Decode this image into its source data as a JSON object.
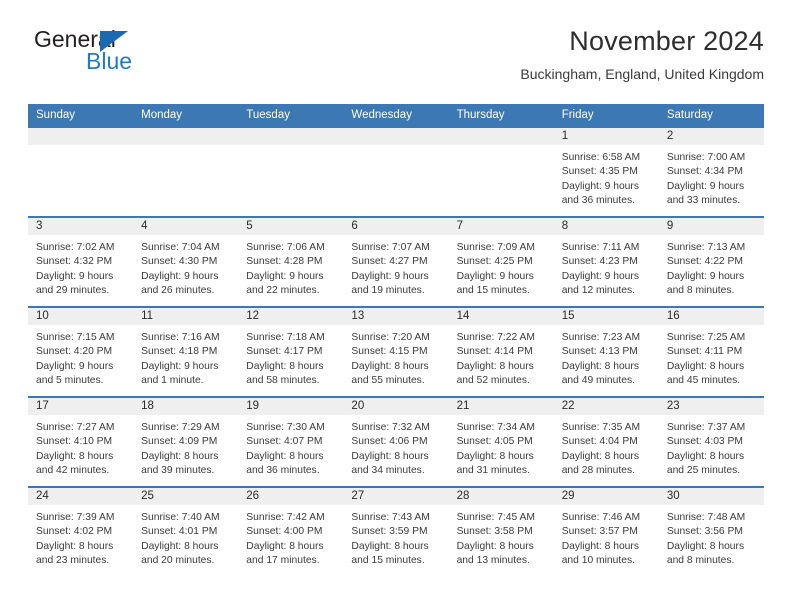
{
  "logo": {
    "primary_text": "General",
    "secondary_text": "Blue",
    "primary_color": "#231f20",
    "secondary_color": "#1e7bc4",
    "triangle_color": "#1b68b3",
    "triangle_icon": "triangle-icon"
  },
  "header": {
    "title": "November 2024",
    "subtitle": "Buckingham, England, United Kingdom"
  },
  "theme": {
    "header_blue": "#3b78b4",
    "daynum_band": "#efefef",
    "text": "#333333"
  },
  "weekday_headers": [
    "Sunday",
    "Monday",
    "Tuesday",
    "Wednesday",
    "Thursday",
    "Friday",
    "Saturday"
  ],
  "labels": {
    "sunrise_prefix": "Sunrise:",
    "sunset_prefix": "Sunset:",
    "daylight_prefix": "Daylight:"
  },
  "weeks": [
    [
      {
        "day": "",
        "sunrise": "",
        "sunset": "",
        "daylight_line1": "",
        "daylight_line2": "",
        "empty": true
      },
      {
        "day": "",
        "sunrise": "",
        "sunset": "",
        "daylight_line1": "",
        "daylight_line2": "",
        "empty": true
      },
      {
        "day": "",
        "sunrise": "",
        "sunset": "",
        "daylight_line1": "",
        "daylight_line2": "",
        "empty": true
      },
      {
        "day": "",
        "sunrise": "",
        "sunset": "",
        "daylight_line1": "",
        "daylight_line2": "",
        "empty": true
      },
      {
        "day": "",
        "sunrise": "",
        "sunset": "",
        "daylight_line1": "",
        "daylight_line2": "",
        "empty": true
      },
      {
        "day": "1",
        "sunrise": "Sunrise: 6:58 AM",
        "sunset": "Sunset: 4:35 PM",
        "daylight_line1": "Daylight: 9 hours",
        "daylight_line2": "and 36 minutes."
      },
      {
        "day": "2",
        "sunrise": "Sunrise: 7:00 AM",
        "sunset": "Sunset: 4:34 PM",
        "daylight_line1": "Daylight: 9 hours",
        "daylight_line2": "and 33 minutes."
      }
    ],
    [
      {
        "day": "3",
        "sunrise": "Sunrise: 7:02 AM",
        "sunset": "Sunset: 4:32 PM",
        "daylight_line1": "Daylight: 9 hours",
        "daylight_line2": "and 29 minutes."
      },
      {
        "day": "4",
        "sunrise": "Sunrise: 7:04 AM",
        "sunset": "Sunset: 4:30 PM",
        "daylight_line1": "Daylight: 9 hours",
        "daylight_line2": "and 26 minutes."
      },
      {
        "day": "5",
        "sunrise": "Sunrise: 7:06 AM",
        "sunset": "Sunset: 4:28 PM",
        "daylight_line1": "Daylight: 9 hours",
        "daylight_line2": "and 22 minutes."
      },
      {
        "day": "6",
        "sunrise": "Sunrise: 7:07 AM",
        "sunset": "Sunset: 4:27 PM",
        "daylight_line1": "Daylight: 9 hours",
        "daylight_line2": "and 19 minutes."
      },
      {
        "day": "7",
        "sunrise": "Sunrise: 7:09 AM",
        "sunset": "Sunset: 4:25 PM",
        "daylight_line1": "Daylight: 9 hours",
        "daylight_line2": "and 15 minutes."
      },
      {
        "day": "8",
        "sunrise": "Sunrise: 7:11 AM",
        "sunset": "Sunset: 4:23 PM",
        "daylight_line1": "Daylight: 9 hours",
        "daylight_line2": "and 12 minutes."
      },
      {
        "day": "9",
        "sunrise": "Sunrise: 7:13 AM",
        "sunset": "Sunset: 4:22 PM",
        "daylight_line1": "Daylight: 9 hours",
        "daylight_line2": "and 8 minutes."
      }
    ],
    [
      {
        "day": "10",
        "sunrise": "Sunrise: 7:15 AM",
        "sunset": "Sunset: 4:20 PM",
        "daylight_line1": "Daylight: 9 hours",
        "daylight_line2": "and 5 minutes."
      },
      {
        "day": "11",
        "sunrise": "Sunrise: 7:16 AM",
        "sunset": "Sunset: 4:18 PM",
        "daylight_line1": "Daylight: 9 hours",
        "daylight_line2": "and 1 minute."
      },
      {
        "day": "12",
        "sunrise": "Sunrise: 7:18 AM",
        "sunset": "Sunset: 4:17 PM",
        "daylight_line1": "Daylight: 8 hours",
        "daylight_line2": "and 58 minutes."
      },
      {
        "day": "13",
        "sunrise": "Sunrise: 7:20 AM",
        "sunset": "Sunset: 4:15 PM",
        "daylight_line1": "Daylight: 8 hours",
        "daylight_line2": "and 55 minutes."
      },
      {
        "day": "14",
        "sunrise": "Sunrise: 7:22 AM",
        "sunset": "Sunset: 4:14 PM",
        "daylight_line1": "Daylight: 8 hours",
        "daylight_line2": "and 52 minutes."
      },
      {
        "day": "15",
        "sunrise": "Sunrise: 7:23 AM",
        "sunset": "Sunset: 4:13 PM",
        "daylight_line1": "Daylight: 8 hours",
        "daylight_line2": "and 49 minutes."
      },
      {
        "day": "16",
        "sunrise": "Sunrise: 7:25 AM",
        "sunset": "Sunset: 4:11 PM",
        "daylight_line1": "Daylight: 8 hours",
        "daylight_line2": "and 45 minutes."
      }
    ],
    [
      {
        "day": "17",
        "sunrise": "Sunrise: 7:27 AM",
        "sunset": "Sunset: 4:10 PM",
        "daylight_line1": "Daylight: 8 hours",
        "daylight_line2": "and 42 minutes."
      },
      {
        "day": "18",
        "sunrise": "Sunrise: 7:29 AM",
        "sunset": "Sunset: 4:09 PM",
        "daylight_line1": "Daylight: 8 hours",
        "daylight_line2": "and 39 minutes."
      },
      {
        "day": "19",
        "sunrise": "Sunrise: 7:30 AM",
        "sunset": "Sunset: 4:07 PM",
        "daylight_line1": "Daylight: 8 hours",
        "daylight_line2": "and 36 minutes."
      },
      {
        "day": "20",
        "sunrise": "Sunrise: 7:32 AM",
        "sunset": "Sunset: 4:06 PM",
        "daylight_line1": "Daylight: 8 hours",
        "daylight_line2": "and 34 minutes."
      },
      {
        "day": "21",
        "sunrise": "Sunrise: 7:34 AM",
        "sunset": "Sunset: 4:05 PM",
        "daylight_line1": "Daylight: 8 hours",
        "daylight_line2": "and 31 minutes."
      },
      {
        "day": "22",
        "sunrise": "Sunrise: 7:35 AM",
        "sunset": "Sunset: 4:04 PM",
        "daylight_line1": "Daylight: 8 hours",
        "daylight_line2": "and 28 minutes."
      },
      {
        "day": "23",
        "sunrise": "Sunrise: 7:37 AM",
        "sunset": "Sunset: 4:03 PM",
        "daylight_line1": "Daylight: 8 hours",
        "daylight_line2": "and 25 minutes."
      }
    ],
    [
      {
        "day": "24",
        "sunrise": "Sunrise: 7:39 AM",
        "sunset": "Sunset: 4:02 PM",
        "daylight_line1": "Daylight: 8 hours",
        "daylight_line2": "and 23 minutes."
      },
      {
        "day": "25",
        "sunrise": "Sunrise: 7:40 AM",
        "sunset": "Sunset: 4:01 PM",
        "daylight_line1": "Daylight: 8 hours",
        "daylight_line2": "and 20 minutes."
      },
      {
        "day": "26",
        "sunrise": "Sunrise: 7:42 AM",
        "sunset": "Sunset: 4:00 PM",
        "daylight_line1": "Daylight: 8 hours",
        "daylight_line2": "and 17 minutes."
      },
      {
        "day": "27",
        "sunrise": "Sunrise: 7:43 AM",
        "sunset": "Sunset: 3:59 PM",
        "daylight_line1": "Daylight: 8 hours",
        "daylight_line2": "and 15 minutes."
      },
      {
        "day": "28",
        "sunrise": "Sunrise: 7:45 AM",
        "sunset": "Sunset: 3:58 PM",
        "daylight_line1": "Daylight: 8 hours",
        "daylight_line2": "and 13 minutes."
      },
      {
        "day": "29",
        "sunrise": "Sunrise: 7:46 AM",
        "sunset": "Sunset: 3:57 PM",
        "daylight_line1": "Daylight: 8 hours",
        "daylight_line2": "and 10 minutes."
      },
      {
        "day": "30",
        "sunrise": "Sunrise: 7:48 AM",
        "sunset": "Sunset: 3:56 PM",
        "daylight_line1": "Daylight: 8 hours",
        "daylight_line2": "and 8 minutes."
      }
    ]
  ]
}
